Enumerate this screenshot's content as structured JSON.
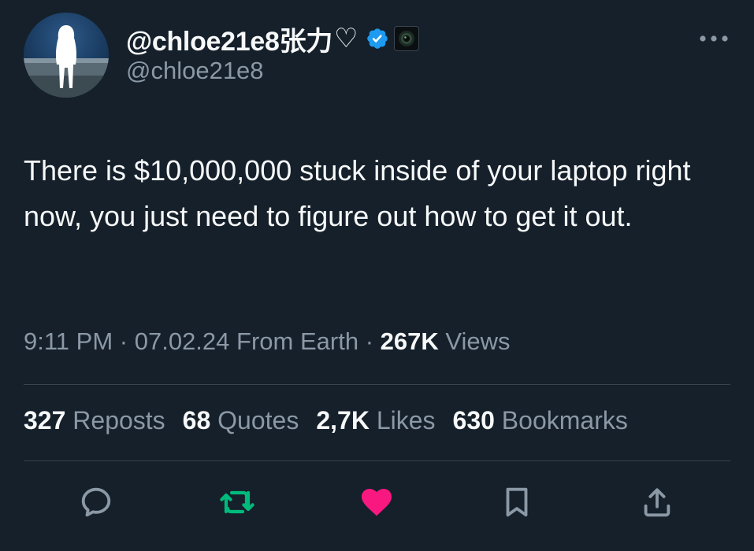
{
  "colors": {
    "background": "#15202b",
    "text": "#f7f9f9",
    "secondary_text": "#8b98a5",
    "divider": "#38444d",
    "verified_badge": "#1d9bf0",
    "repost_active": "#00ba7c",
    "like_active": "#f91880"
  },
  "author": {
    "display_name": "@chloe21e8张力",
    "heart_glyph": "♡",
    "handle": "@chloe21e8",
    "verified_icon": "verified-badge-icon",
    "affiliate_icon": "affiliate-badge-icon"
  },
  "tweet": {
    "text": "There is $10,000,000 stuck inside of your laptop right now, you just need to figure out how to get it out."
  },
  "meta": {
    "time": "9:11 PM",
    "sep1": "·",
    "date": "07.02.24",
    "source": "From Earth",
    "sep2": "·",
    "views_count": "267K",
    "views_label": "Views"
  },
  "stats": [
    {
      "count": "327",
      "label": "Reposts"
    },
    {
      "count": "68",
      "label": "Quotes"
    },
    {
      "count": "2,7K",
      "label": "Likes"
    },
    {
      "count": "630",
      "label": "Bookmarks"
    }
  ],
  "actions": [
    {
      "icon": "reply-icon",
      "state": "default"
    },
    {
      "icon": "repost-icon",
      "state": "active"
    },
    {
      "icon": "like-icon",
      "state": "active"
    },
    {
      "icon": "bookmark-icon",
      "state": "default"
    },
    {
      "icon": "share-icon",
      "state": "default"
    }
  ],
  "menu": {
    "icon": "more-options-icon"
  }
}
